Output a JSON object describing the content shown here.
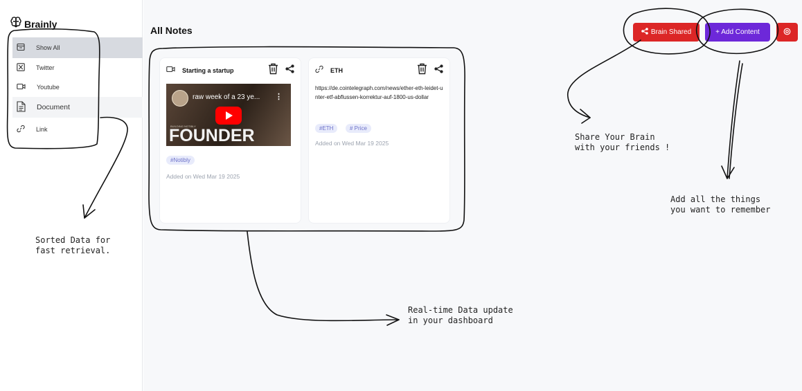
{
  "app": {
    "brand": "Brainly"
  },
  "sidebar": {
    "items": [
      {
        "label": "Show All",
        "icon": "show-all-icon"
      },
      {
        "label": "Twitter",
        "icon": "twitter-icon"
      },
      {
        "label": "Youtube",
        "icon": "youtube-icon"
      },
      {
        "label": "Document",
        "icon": "document-icon"
      },
      {
        "label": "Link",
        "icon": "link-icon"
      }
    ]
  },
  "header": {
    "title": "All Notes",
    "share_label": "Brain Shared",
    "add_label": "+ Add Content"
  },
  "cards": [
    {
      "title": "Starting a startup",
      "type": "youtube",
      "video_title": "raw week of a 23 ye...",
      "thumb_small": "BUILDING NOTIBLY",
      "thumb_big": "FOUNDER",
      "tags": [
        "#Notibly"
      ],
      "added": "Added on Wed Mar 19 2025"
    },
    {
      "title": "ETH",
      "type": "link",
      "url": "https://de.cointelegraph.com/news/ether-eth-leidet-unter-etf-abflussen-korrektur-auf-1800-us-dollar",
      "tags": [
        "#ETH",
        "# Price"
      ],
      "added": "Added on Wed Mar 19 2025"
    }
  ],
  "annotations": {
    "sorted": "Sorted Data for\nfast retrieval.",
    "realtime": "Real-time Data update\nin your dashboard",
    "share": "Share Your Brain\nwith your friends !",
    "add": "Add all the things\nyou want to remember"
  },
  "colors": {
    "share_button": "#dc2626",
    "add_button": "#6d28d9",
    "active_nav": "#d7dae0",
    "tag_bg": "#e8ebfb",
    "tag_text": "#6d72c9"
  }
}
